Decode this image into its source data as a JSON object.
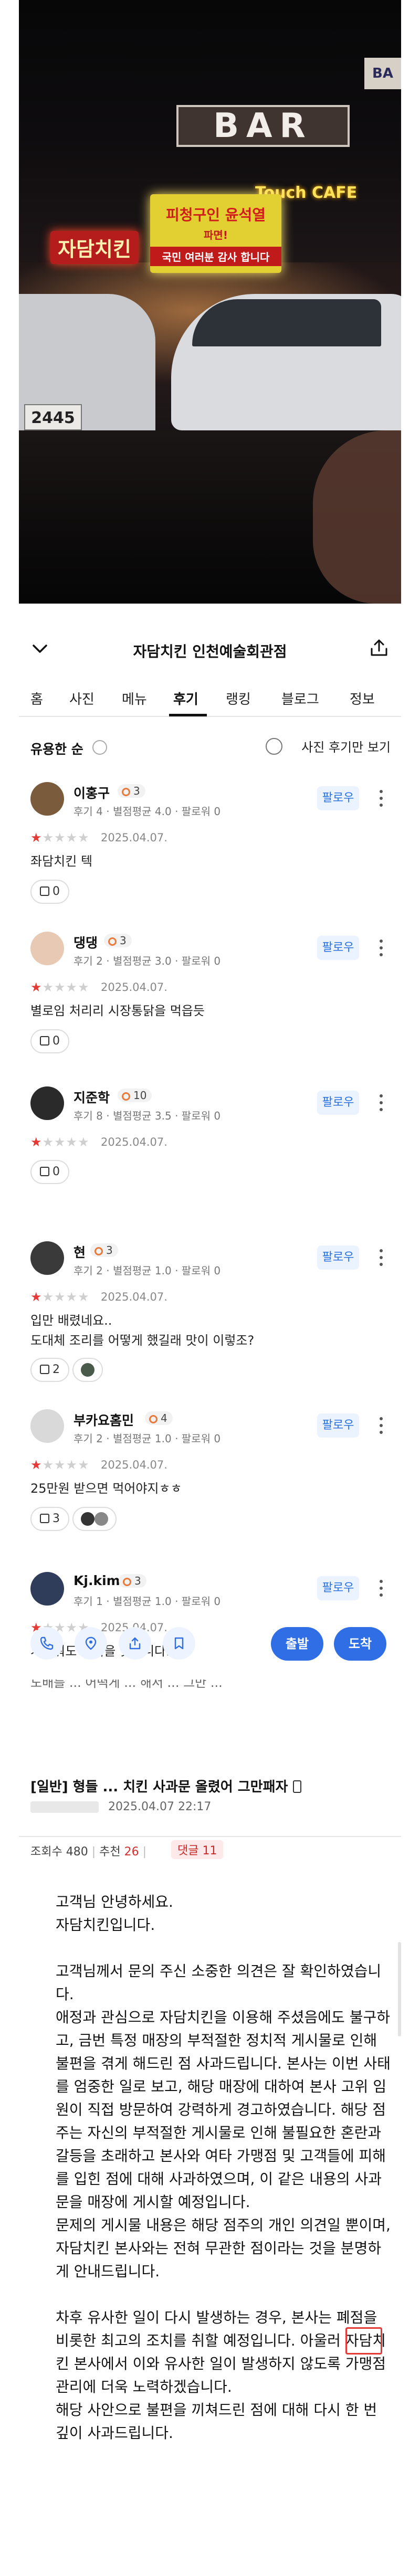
{
  "photo": {
    "bar_sign": "BAR",
    "cafe_sign": "Touch CAFE",
    "chicken_sign": "자담치킨",
    "banner_line1": "피청구인 윤석열",
    "banner_line2": "파면!",
    "banner_line3": "국민 여러분 감사 합니다",
    "top_right_sign": "BA",
    "plate": "2445"
  },
  "app": {
    "title": "자담치킨 인천예술회관점",
    "tabs": [
      "홈",
      "사진",
      "메뉴",
      "후기",
      "랭킹",
      "블로그",
      "정보"
    ],
    "active_tab": "후기",
    "sort_label": "유용한 순",
    "photo_filter": "사진 후기만 보기",
    "follow_label": "팔로우",
    "reviews": [
      {
        "name": "이홍구",
        "level": "3",
        "stats": "후기 4 · 별점평균 4.0 · 팔로워 0",
        "rating": 1,
        "date": "2025.04.07.",
        "text": "좌담치킨 텍",
        "likes": "0",
        "avatar_color": "#7a5b3c"
      },
      {
        "name": "댕댕",
        "level": "3",
        "stats": "후기 2 · 별점평균 3.0 · 팔로워 0",
        "rating": 1,
        "date": "2025.04.07.",
        "text": "별로임 처리리 시장통닭을 먹읍듯",
        "likes": "0",
        "avatar_color": "#e8c9b4"
      },
      {
        "name": "지준학",
        "level": "10",
        "stats": "후기 8 · 별점평균 3.5 · 팔로워 0",
        "rating": 1,
        "date": "2025.04.07.",
        "text": "",
        "likes": "0",
        "avatar_color": "#2a2a2a"
      },
      {
        "name": "현",
        "level": "3",
        "stats": "후기 2 · 별점평균 1.0 · 팔로워 0",
        "rating": 1,
        "date": "2025.04.07.",
        "text": "입만 배렸네요..\n도대체 조리를 어떻게 했길래 맛이 이렇조?",
        "likes": "2",
        "avatar_color": "#3a3a3a"
      },
      {
        "name": "부카요홈민",
        "level": "4",
        "stats": "후기 2 · 별점평균 1.0 · 팔로워 0",
        "rating": 1,
        "date": "2025.04.07.",
        "text": "25만원 받으면 먹어야지ㅎㅎ",
        "likes": "3",
        "avatar_color": "#d9d9d9"
      },
      {
        "name": "Kj.kim",
        "level": "3",
        "stats": "후기 1 · 별점평균 1.0 · 팔로워 0",
        "rating": 1,
        "date": "2025.04.07.",
        "text": "거져줘도 안먹을 맛입니다. 텍",
        "likes": "",
        "avatar_color": "#2f3d5a"
      }
    ],
    "depart_label": "출발",
    "arrive_label": "도착",
    "cut_text": "도배를 ... 어떡게 ... 해서 ... 그만 ..."
  },
  "post": {
    "title": "[일반] 형들 ... 치킨 사과문 올렸어 그만패자",
    "date": "2025.04.07 22:17",
    "views_label": "조회수 480",
    "recommend_label": "추천",
    "recommend_count": "26",
    "comments_label": "댓글",
    "comments_count": "11",
    "body": {
      "greeting1": "고객님 안녕하세요.",
      "greeting2": "자담치킨입니다.",
      "para1": "고객님께서 문의 주신 소중한 의견은 잘 확인하였습니다.",
      "para2": "애정과 관심으로 자담치킨을 이용해 주셨음에도 불구하고, 금번 특정 매장의 부적절한 정치적 게시물로 인해 불편을 겪게 해드린 점 사과드립니다. 본사는 이번 사태를 엄중한 일로 보고, 해당 매장에 대하여 본사 고위 임원이 직접 방문하여 강력하게 경고하였습니다. 해당 점주는 자신의 부적절한 게시물로 인해 불필요한 혼란과 갈등을 초래하고 본사와 여타 가맹점 및 고객들에 피해를 입힌 점에 대해 사과하였으며, 이 같은 내용의 사과문을 매장에 게시할 예정입니다.",
      "para3": "문제의 게시물 내용은 해당 점주의 개인 의견일 뿐이며, 자담치킨 본사와는 전혀 무관한 점이라는 것을 분명하게 안내드립니다.",
      "para4_a": "차후 유사한 일이 다시 발생하는 경우, 본사는",
      "para4_closure": "폐점",
      "para4_b": "을 비롯한 최고의 조치를 취할 예정입니다. 아울러 자담치킨 본사에서 이와 유사한 일이 발생하지 않도록 가맹점 관리에 더욱 노력하겠습니다.",
      "para5": "해당 사안으로 불편을 끼쳐드린 점에 대해 다시 한 번 깊이 사과드립니다."
    }
  }
}
